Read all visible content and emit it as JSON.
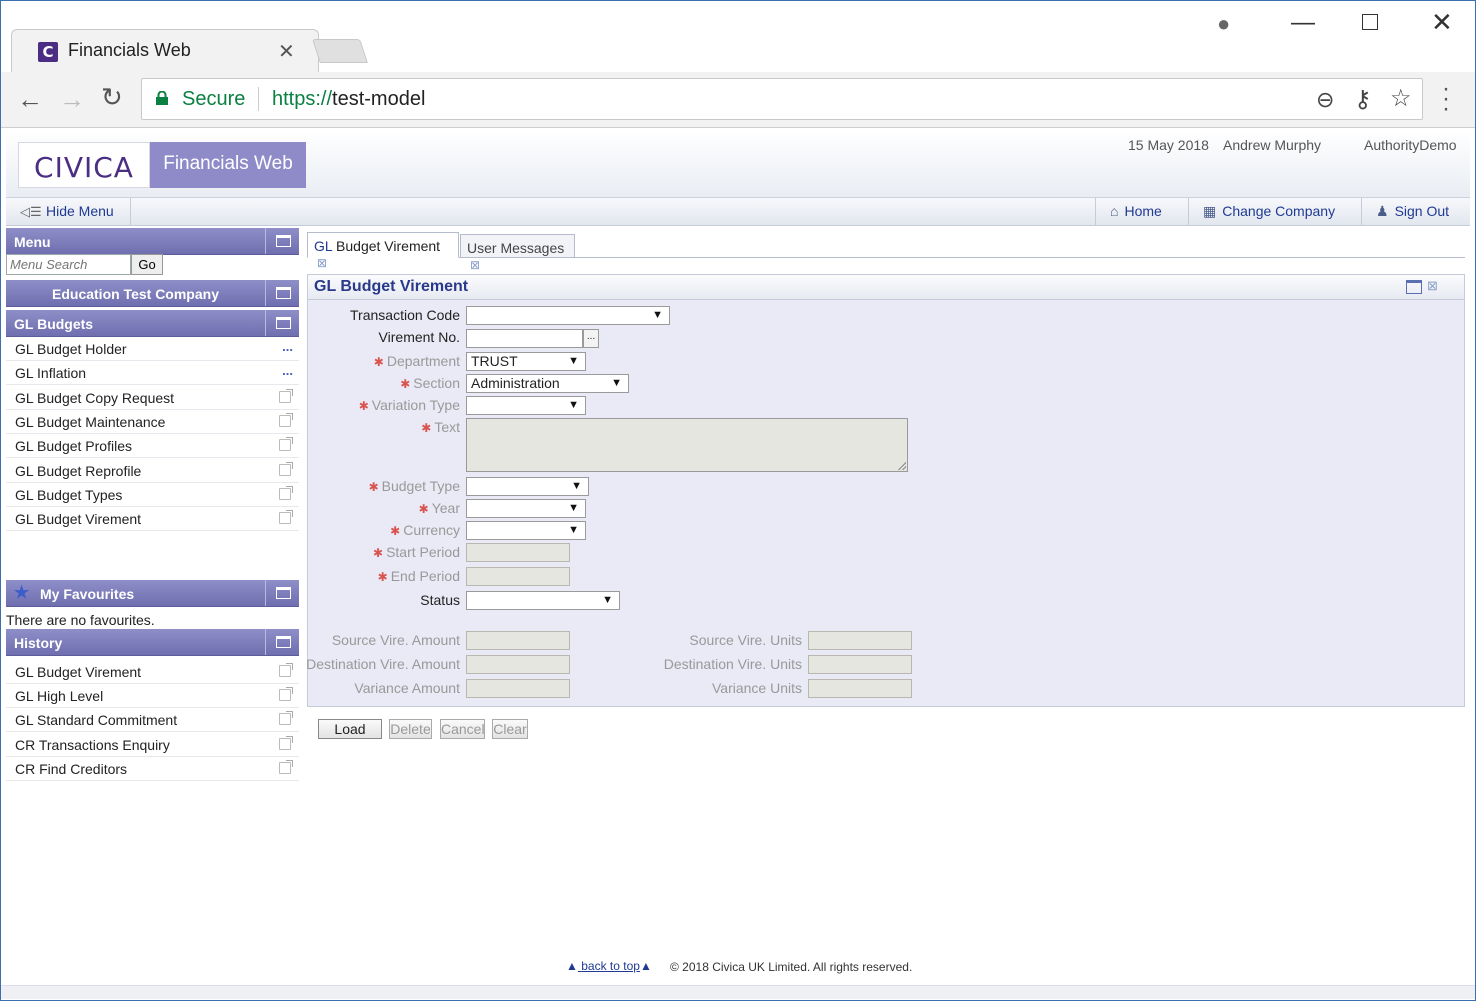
{
  "browser": {
    "tab_title": "Financials Web",
    "tab_favicon_letter": "C",
    "secure_label": "Secure",
    "url_scheme": "https://",
    "url_host": "test-model"
  },
  "header": {
    "logo": "CIVICA",
    "product": "Financials Web",
    "date": "15 May 2018",
    "user": "Andrew Murphy",
    "authority": "AuthorityDemo"
  },
  "nav": {
    "hide_menu": "Hide Menu",
    "home": "Home",
    "change_company": "Change Company",
    "sign_out": "Sign Out"
  },
  "sidebar": {
    "menu_title": "Menu",
    "search_placeholder": "Menu Search",
    "go_label": "Go",
    "company": "Education Test Company",
    "section_title": "GL Budgets",
    "items": [
      {
        "label": "GL Budget Holder",
        "marker": "..."
      },
      {
        "label": "GL Inflation",
        "marker": "..."
      },
      {
        "label": "GL Budget Copy Request"
      },
      {
        "label": "GL Budget Maintenance"
      },
      {
        "label": "GL Budget Profiles"
      },
      {
        "label": "GL Budget Reprofile"
      },
      {
        "label": "GL Budget Types"
      },
      {
        "label": "GL Budget Virement"
      }
    ],
    "favourites_title": "My Favourites",
    "favourites_empty": "There are no favourites.",
    "history_title": "History",
    "history": [
      {
        "label": "GL Budget Virement"
      },
      {
        "label": "GL High Level"
      },
      {
        "label": "GL Standard Commitment"
      },
      {
        "label": "CR Transactions Enquiry"
      },
      {
        "label": "CR Find Creditors"
      }
    ]
  },
  "tabs": [
    {
      "prefix": "GL",
      "label": " Budget Virement"
    },
    {
      "label": "User Messages"
    }
  ],
  "form": {
    "title": "GL Budget Virement",
    "transaction_code": {
      "label": "Transaction Code",
      "value": ""
    },
    "virement_no": {
      "label": "Virement No.",
      "value": "",
      "lookup": "..."
    },
    "department": {
      "label": "Department",
      "value": "TRUST"
    },
    "section": {
      "label": "Section",
      "value": "Administration"
    },
    "variation_type": {
      "label": "Variation Type",
      "value": ""
    },
    "text": {
      "label": "Text",
      "value": ""
    },
    "budget_type": {
      "label": "Budget Type",
      "value": ""
    },
    "year": {
      "label": "Year",
      "value": ""
    },
    "currency": {
      "label": "Currency",
      "value": ""
    },
    "start_period": {
      "label": "Start Period",
      "value": ""
    },
    "end_period": {
      "label": "End Period",
      "value": ""
    },
    "status": {
      "label": "Status",
      "value": ""
    },
    "source_amount": {
      "label": "Source Vire. Amount",
      "value": ""
    },
    "destination_amount": {
      "label": "Destination Vire. Amount",
      "value": ""
    },
    "variance_amount": {
      "label": "Variance Amount",
      "value": ""
    },
    "source_units": {
      "label": "Source Vire. Units",
      "value": ""
    },
    "destination_units": {
      "label": "Destination Vire. Units",
      "value": ""
    },
    "variance_units": {
      "label": "Variance Units",
      "value": ""
    }
  },
  "buttons": {
    "load": "Load",
    "delete": "Delete",
    "cancel": "Cancel",
    "clear": "Clear"
  },
  "footer": {
    "back_to_top": "back to top",
    "copyright": "© 2018 Civica UK Limited. All rights reserved."
  },
  "colors": {
    "menu_header": "#7b7bbb",
    "product_box": "#8f8bc9",
    "brand_purple": "#4b2e83",
    "panel_bg": "#eaeaf6",
    "required_star": "#d9534f",
    "secure_green": "#0b8043"
  }
}
